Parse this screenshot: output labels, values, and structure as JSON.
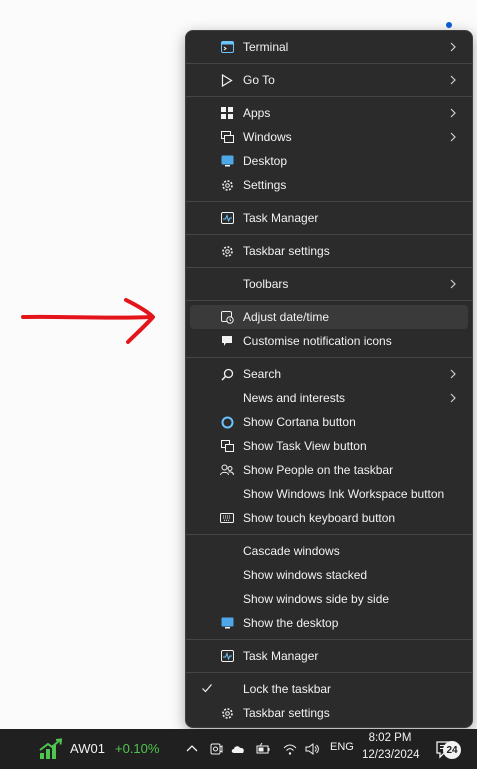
{
  "menu": {
    "items": [
      {
        "label": "Terminal",
        "icon": "terminal-icon",
        "submenu": true
      },
      {
        "label": "Go To",
        "icon": "goto-icon",
        "submenu": true
      },
      {
        "label": "Apps",
        "icon": "apps-icon",
        "submenu": true
      },
      {
        "label": "Windows",
        "icon": "windows-icon",
        "submenu": true
      },
      {
        "label": "Desktop",
        "icon": "desktop-icon"
      },
      {
        "label": "Settings",
        "icon": "gear-icon"
      },
      {
        "label": "Task Manager",
        "icon": "task-manager-icon"
      },
      {
        "label": "Taskbar settings",
        "icon": "gear-icon"
      },
      {
        "label": "Toolbars",
        "submenu": true
      },
      {
        "label": "Adjust date/time",
        "icon": "clock-icon",
        "highlighted": true
      },
      {
        "label": "Customise notification icons",
        "icon": "notification-icon"
      },
      {
        "label": "Search",
        "icon": "search-icon",
        "submenu": true
      },
      {
        "label": "News and interests",
        "submenu": true
      },
      {
        "label": "Show Cortana button",
        "icon": "cortana-icon"
      },
      {
        "label": "Show Task View button",
        "icon": "task-view-icon"
      },
      {
        "label": "Show People on the taskbar",
        "icon": "people-icon"
      },
      {
        "label": "Show Windows Ink Workspace button"
      },
      {
        "label": "Show touch keyboard button",
        "icon": "keyboard-icon"
      },
      {
        "label": "Cascade windows"
      },
      {
        "label": "Show windows stacked"
      },
      {
        "label": "Show windows side by side"
      },
      {
        "label": "Show the desktop",
        "icon": "desktop-icon"
      },
      {
        "label": "Task Manager",
        "icon": "task-manager-icon"
      },
      {
        "label": "Lock the taskbar",
        "checked": true
      },
      {
        "label": "Taskbar settings",
        "icon": "gear-icon"
      }
    ]
  },
  "taskbar": {
    "stock_name": "AW01",
    "stock_change": "+0.10%",
    "language": "ENG",
    "time": "8:02 PM",
    "date": "12/23/2024",
    "notification_count": "24"
  },
  "colors": {
    "menu_bg": "#2b2b2b",
    "taskbar_bg": "#202020",
    "stock_green": "#4fc44f",
    "annotation_red": "#e3151b"
  }
}
